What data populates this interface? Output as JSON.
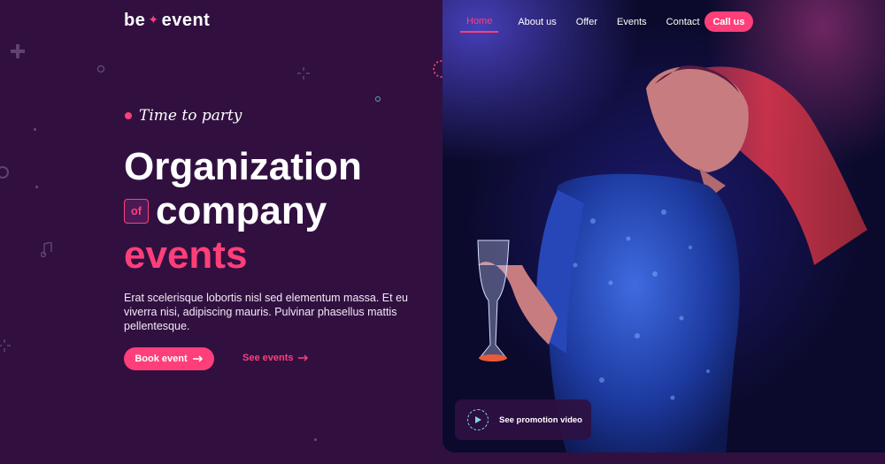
{
  "brand": {
    "logo_left": "be",
    "logo_right": "event",
    "accent_color": "#ff3f79",
    "background_color": "#311040"
  },
  "nav": {
    "items": [
      {
        "label": "Home",
        "active": true
      },
      {
        "label": "About us",
        "active": false
      },
      {
        "label": "Offer",
        "active": false
      },
      {
        "label": "Events",
        "active": false
      },
      {
        "label": "Contact",
        "active": false
      }
    ],
    "call_label": "Call us"
  },
  "hero": {
    "tagline": "Time to party",
    "title_line1": "Organization",
    "title_of": "of",
    "title_line2": "company",
    "title_line3": "events",
    "description": "Erat scelerisque lobortis nisl sed elementum massa. Et eu viverra nisi, adipiscing mauris. Pulvinar phasellus mattis pellentesque.",
    "book_label": "Book event",
    "see_label": "See events"
  },
  "promo": {
    "label": "See promotion video",
    "icon": "play-icon"
  }
}
